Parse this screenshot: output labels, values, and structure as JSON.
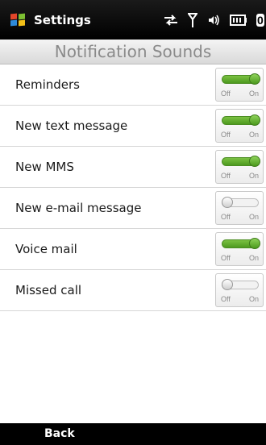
{
  "status_bar": {
    "app_title": "Settings",
    "battery_text": "0",
    "icons": [
      "windows-logo",
      "data-sync-icon",
      "signal-icon",
      "volume-icon",
      "battery-icon"
    ]
  },
  "header": {
    "title": "Notification Sounds"
  },
  "settings": [
    {
      "label": "Reminders",
      "state": "on"
    },
    {
      "label": "New text message",
      "state": "on"
    },
    {
      "label": "New MMS",
      "state": "on"
    },
    {
      "label": "New e-mail message",
      "state": "off"
    },
    {
      "label": "Voice mail",
      "state": "on"
    },
    {
      "label": "Missed call",
      "state": "off"
    }
  ],
  "toggle_labels": {
    "off": "Off",
    "on": "On"
  },
  "footer": {
    "back_label": "Back"
  },
  "colors": {
    "toggle_on": "#5aaa28",
    "bar_bg": "#000000",
    "title_text": "#8a8a8a"
  }
}
